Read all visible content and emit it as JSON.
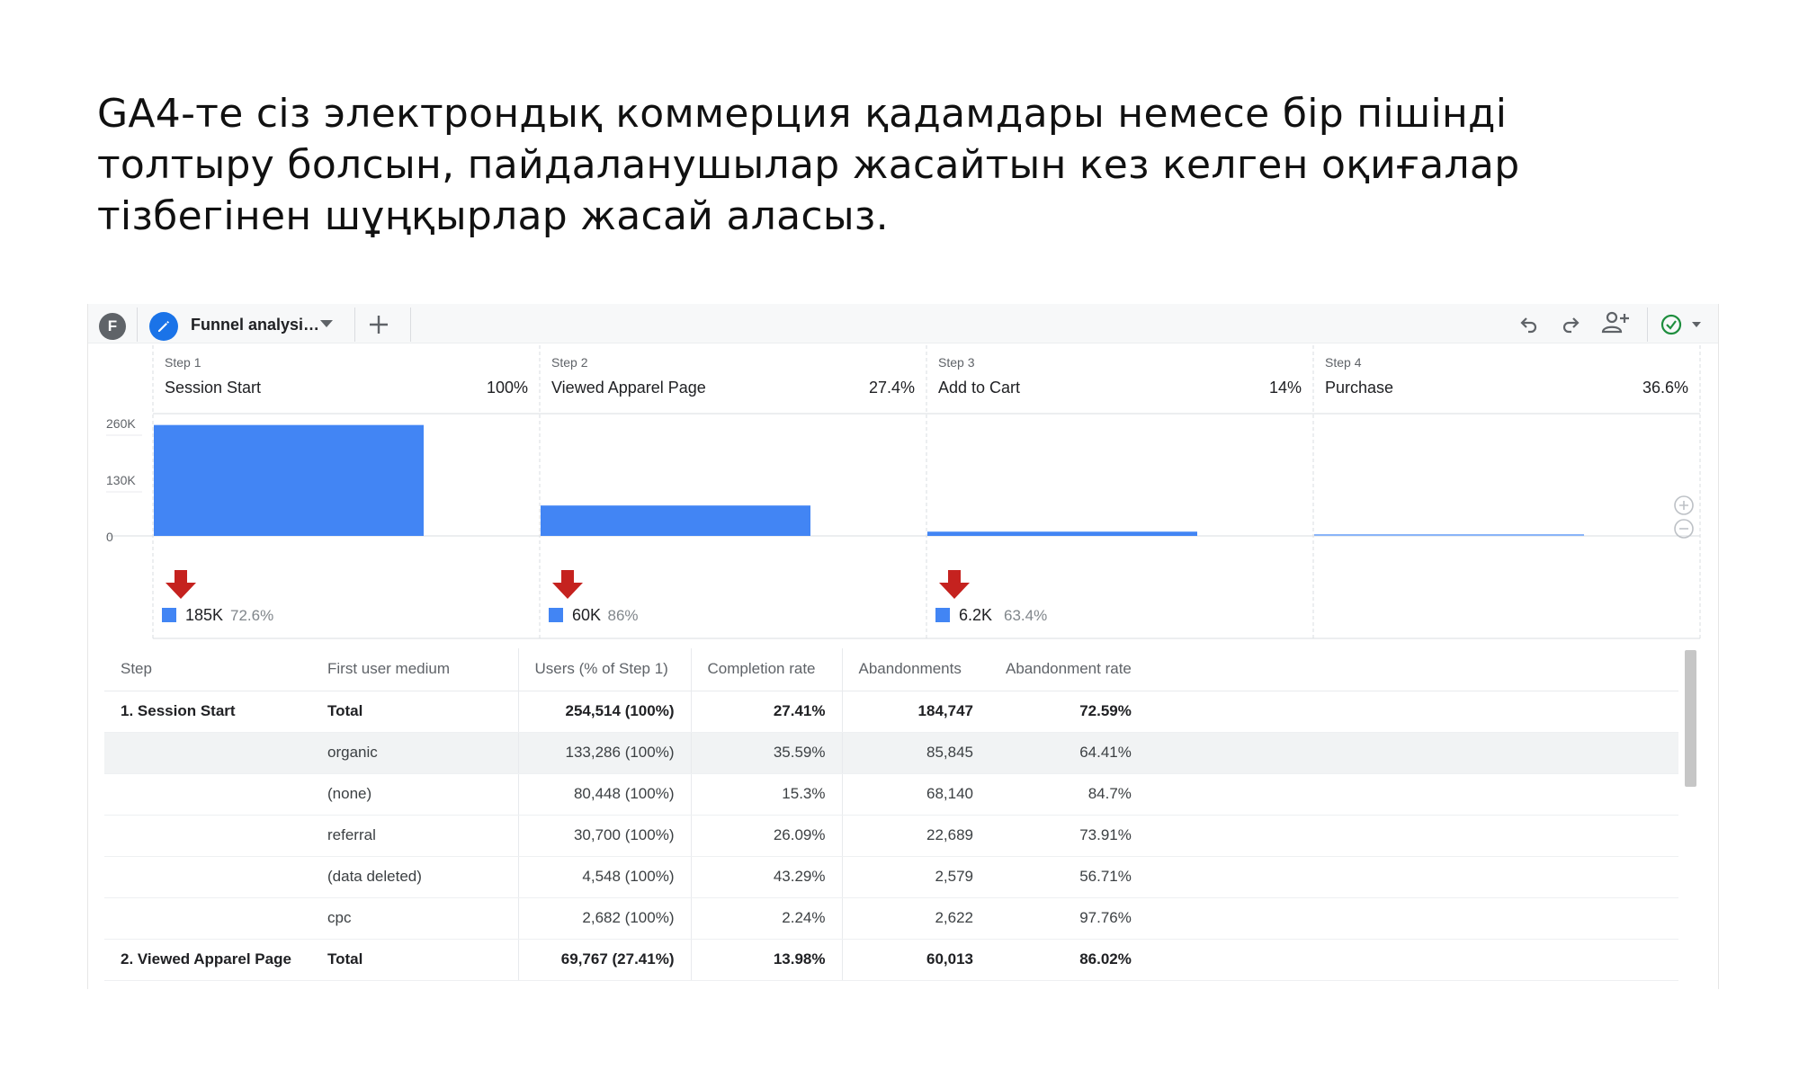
{
  "headline": {
    "line1": "GA4-те сіз электрондық коммерция қадамдары немесе бір пішінді",
    "line2": "толтыру болсын, пайдаланушылар жасайтын кез келген оқиғалар",
    "line3": "тізбегінен шұңқырлар жасай аласыз."
  },
  "tabbar": {
    "avatar_letter": "F",
    "tab_label": "Funnel analysi…",
    "icons": [
      "edit-pencil-icon",
      "dropdown-caret-icon",
      "add-tab-icon",
      "undo-icon",
      "redo-icon",
      "share-user-icon",
      "check-circle-icon"
    ],
    "accent": "#1a73e8",
    "status_color": "#1e8e3e"
  },
  "chart_data": {
    "type": "bar",
    "categories": [
      "Session Start",
      "Viewed Apparel Page",
      "Add to Cart",
      "Purchase"
    ],
    "step_labels": [
      "Step 1",
      "Step 2",
      "Step 3",
      "Step 4"
    ],
    "step_percents": [
      "100%",
      "27.4%",
      "14%",
      "36.6%"
    ],
    "values": [
      254514,
      69767,
      9760,
      3570
    ],
    "ylim": [
      0,
      260000
    ],
    "yticks": [
      {
        "value": 260000,
        "label": "260K"
      },
      {
        "value": 130000,
        "label": "130K"
      },
      {
        "value": 0,
        "label": "0"
      }
    ],
    "abandonments": [
      {
        "count": "185K",
        "rate": "72.6%"
      },
      {
        "count": "60K",
        "rate": "86%"
      },
      {
        "count": "6.2K",
        "rate": "63.4%"
      }
    ],
    "bar_color": "#4285f4",
    "drop_arrow_color": "#c5221f"
  },
  "table": {
    "headers": [
      "Step",
      "First user medium",
      "Users (% of Step 1)",
      "Completion rate",
      "Abandonments",
      "Abandonment rate"
    ],
    "rows": [
      {
        "step": "1. Session Start",
        "medium": "Total",
        "users": "254,514 (100%)",
        "completion": "27.41%",
        "abandonments": "184,747",
        "abandonment_rate": "72.59%"
      },
      {
        "step": "",
        "medium": "organic",
        "users": "133,286 (100%)",
        "completion": "35.59%",
        "abandonments": "85,845",
        "abandonment_rate": "64.41%"
      },
      {
        "step": "",
        "medium": "(none)",
        "users": "80,448 (100%)",
        "completion": "15.3%",
        "abandonments": "68,140",
        "abandonment_rate": "84.7%"
      },
      {
        "step": "",
        "medium": "referral",
        "users": "30,700 (100%)",
        "completion": "26.09%",
        "abandonments": "22,689",
        "abandonment_rate": "73.91%"
      },
      {
        "step": "",
        "medium": "(data deleted)",
        "users": "4,548 (100%)",
        "completion": "43.29%",
        "abandonments": "2,579",
        "abandonment_rate": "56.71%"
      },
      {
        "step": "",
        "medium": "cpc",
        "users": "2,682 (100%)",
        "completion": "2.24%",
        "abandonments": "2,622",
        "abandonment_rate": "97.76%"
      },
      {
        "step": "2. Viewed Apparel Page",
        "medium": "Total",
        "users": "69,767 (27.41%)",
        "completion": "13.98%",
        "abandonments": "60,013",
        "abandonment_rate": "86.02%"
      }
    ]
  }
}
